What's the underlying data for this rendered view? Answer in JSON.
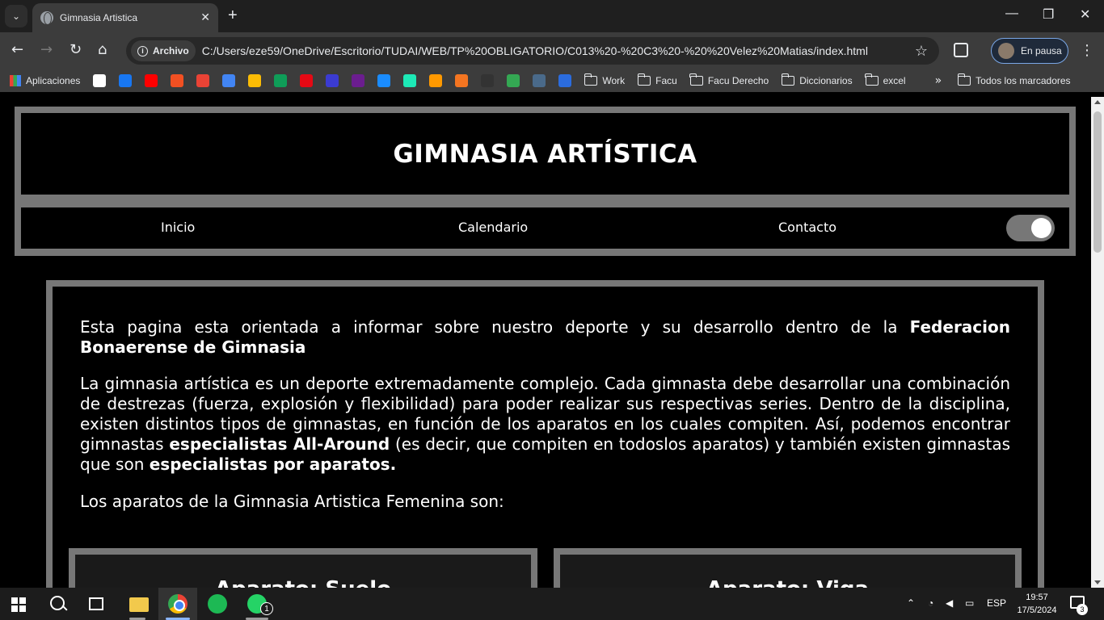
{
  "browser": {
    "tab_title": "Gimnasia Artistica",
    "tab_close": "✕",
    "new_tab": "+",
    "window_controls": {
      "minimize": "—",
      "maximize": "❐",
      "close": "✕"
    },
    "site_chip": "Archivo",
    "url": "C:/Users/eze59/OneDrive/Escritorio/TUDAI/WEB/TP%20OBLIGATORIO/C013%20-%20C3%20-%20%20Velez%20Matias/index.html",
    "profile_label": "En pausa",
    "bookmarks": {
      "apps": "Aplicaciones",
      "favicons": [
        {
          "name": "google",
          "color": "#ffffff"
        },
        {
          "name": "facebook",
          "color": "#1877f2"
        },
        {
          "name": "youtube",
          "color": "#ff0000"
        },
        {
          "name": "microsoft",
          "color": "#f25022"
        },
        {
          "name": "gmail",
          "color": "#ea4335"
        },
        {
          "name": "calendar",
          "color": "#4285f4"
        },
        {
          "name": "keep",
          "color": "#fbbc05"
        },
        {
          "name": "hangouts",
          "color": "#0f9d58"
        },
        {
          "name": "netflix",
          "color": "#e50914"
        },
        {
          "name": "site-blue",
          "color": "#3b3bd1"
        },
        {
          "name": "site-m",
          "color": "#6b1d8f"
        },
        {
          "name": "edge",
          "color": "#1a8cff"
        },
        {
          "name": "play",
          "color": "#1de9b6"
        },
        {
          "name": "amazon",
          "color": "#ff9900"
        },
        {
          "name": "crunchyroll",
          "color": "#f47521"
        },
        {
          "name": "af",
          "color": "#333333"
        },
        {
          "name": "maps",
          "color": "#34a853"
        },
        {
          "name": "cloud",
          "color": "#4a6a8a"
        },
        {
          "name": "lambda",
          "color": "#2b6cde"
        }
      ],
      "folders": [
        "Work",
        "Facu",
        "Facu Derecho",
        "Diccionarios",
        "excel"
      ],
      "overflow": "»",
      "all_bookmarks": "Todos los marcadores"
    }
  },
  "page": {
    "site_title": "GIMNASIA ARTÍSTICA",
    "nav": [
      "Inicio",
      "Calendario",
      "Contacto"
    ],
    "theme_toggle_on": true,
    "intro": {
      "text": "Esta pagina esta orientada a informar sobre nuestro deporte y su desarrollo dentro de la ",
      "bold": "Federacion Bonaerense de Gimnasia"
    },
    "description": {
      "part1": "La gimnasia artística es un deporte extremadamente complejo. Cada gimnasta debe desarrollar una combinación de destrezas (fuerza, explosión y flexibilidad) para poder realizar sus respectivas series. Dentro de la disciplina, existen distintos tipos de gimnastas, en función de los aparatos en los cuales compiten. Así, podemos encontrar gimnastas ",
      "bold1": "especialistas All-Around",
      "part2": " (es decir, que compiten en todoslos aparatos) y también existen gimnastas que son ",
      "bold2": "especialistas por aparatos."
    },
    "apparatus_intro": "Los aparatos de la Gimnasia Artistica Femenina son:",
    "cards": [
      "Aparato: Suelo",
      "Aparato: Viga"
    ]
  },
  "taskbar": {
    "whatsapp_badge": "1",
    "language": "ESP",
    "time": "19:57",
    "date": "17/5/2024",
    "notifications": "3"
  }
}
